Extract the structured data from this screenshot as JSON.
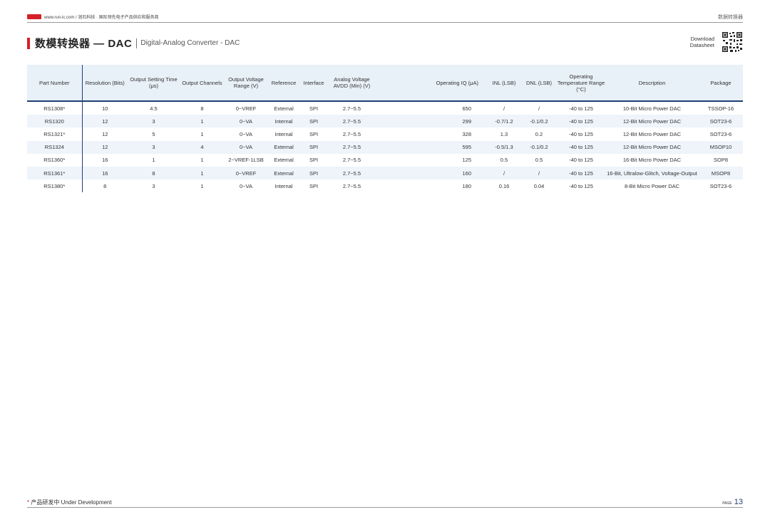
{
  "header": {
    "site": "www.run-ic.com / 润石科技 · 国际领先电子产品供应和服务商",
    "section": "数据转换器"
  },
  "page_title": {
    "main": "数模转换器 — DAC",
    "sub": "Digital-Analog Converter - DAC"
  },
  "download": {
    "line1": "Download",
    "line2": "Datasheet"
  },
  "table": {
    "headers": [
      "Part Number",
      "Resolution (Bits)",
      "Output Setting Time (μs)",
      "Output Channels",
      "Output Voltage Range (V)",
      "Reference",
      "Interface",
      "Analog Voltage AVDD (Min) (V)",
      "Operating IQ (μA)",
      "INL (LSB)",
      "DNL (LSB)",
      "Operating Temperature Range (°C)",
      "Description",
      "Package"
    ],
    "rows": [
      [
        "RS1308*",
        "10",
        "4.5",
        "8",
        "0~VREF",
        "External",
        "SPI",
        "2.7~5.5",
        "650",
        "/",
        "/",
        "-40 to 125",
        "10-Bit Micro Power DAC",
        "TSSOP-16"
      ],
      [
        "RS1320",
        "12",
        "3",
        "1",
        "0~VA",
        "Internal",
        "SPI",
        "2.7~5.5",
        "299",
        "-0.7/1.2",
        "-0.1/0.2",
        "-40 to 125",
        "12-Bit Micro Power DAC",
        "SOT23-6"
      ],
      [
        "RS1321*",
        "12",
        "5",
        "1",
        "0~VA",
        "Internal",
        "SPI",
        "2.7~5.5",
        "328",
        "1.3",
        "0.2",
        "-40 to 125",
        "12-Bit Micro Power DAC",
        "SOT23-6"
      ],
      [
        "RS1324",
        "12",
        "3",
        "4",
        "0~VA",
        "External",
        "SPI",
        "2.7~5.5",
        "595",
        "-0.5/1.3",
        "-0.1/0.2",
        "-40 to 125",
        "12-Bit Micro Power DAC",
        "MSOP10"
      ],
      [
        "RS1360*",
        "16",
        "1",
        "1",
        "2~VREF-1LSB",
        "External",
        "SPI",
        "2.7~5.5",
        "125",
        "0.5",
        "0.5",
        "-40 to 125",
        "16-Bit Micro Power DAC",
        "SOP8"
      ],
      [
        "RS1361*",
        "16",
        "8",
        "1",
        "0~VREF",
        "External",
        "SPI",
        "2.7~5.5",
        "160",
        "/",
        "/",
        "-40 to 125",
        "16-Bit, Ultralow-Glitch, Voltage-Output",
        "MSOP8"
      ],
      [
        "RS1380*",
        "8",
        "3",
        "1",
        "0~VA",
        "Internal",
        "SPI",
        "2.7~5.5",
        "180",
        "0.16",
        "0.04",
        "-40 to 125",
        "8-Bit Micro Power DAC",
        "SOT23-6"
      ]
    ]
  },
  "footer": {
    "star": "*",
    "note": "产品研发中 Under Development",
    "page_label": "PAGE",
    "page_number": "13"
  },
  "colors": {
    "accent_red": "#d62027",
    "navy": "#1f3f72",
    "header_bg": "#e8f0f8"
  }
}
